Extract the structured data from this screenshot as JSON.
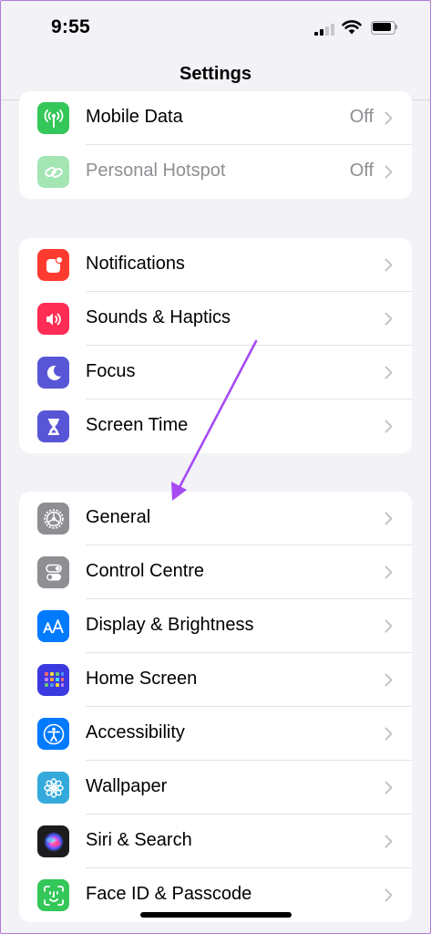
{
  "status": {
    "time": "9:55"
  },
  "nav": {
    "title": "Settings"
  },
  "groups": [
    {
      "items": [
        {
          "label": "Mobile Data",
          "value": "Off",
          "icon": "antenna-icon",
          "color": "#34c759"
        },
        {
          "label": "Personal Hotspot",
          "value": "Off",
          "icon": "link-icon",
          "color": "#34c759",
          "disabled": true
        }
      ]
    },
    {
      "items": [
        {
          "label": "Notifications",
          "icon": "bell-icon",
          "color": "#ff3b30"
        },
        {
          "label": "Sounds & Haptics",
          "icon": "speaker-icon",
          "color": "#ff2d55"
        },
        {
          "label": "Focus",
          "icon": "moon-icon",
          "color": "#5856d6"
        },
        {
          "label": "Screen Time",
          "icon": "hourglass-icon",
          "color": "#5856d6"
        }
      ]
    },
    {
      "items": [
        {
          "label": "General",
          "icon": "gear-icon",
          "color": "#8e8e93"
        },
        {
          "label": "Control Centre",
          "icon": "toggles-icon",
          "color": "#8e8e93"
        },
        {
          "label": "Display & Brightness",
          "icon": "text-size-icon",
          "color": "#007aff"
        },
        {
          "label": "Home Screen",
          "icon": "app-grid-icon",
          "color": "#3a3ae0"
        },
        {
          "label": "Accessibility",
          "icon": "accessibility-icon",
          "color": "#007aff"
        },
        {
          "label": "Wallpaper",
          "icon": "flower-icon",
          "color": "#34aadc"
        },
        {
          "label": "Siri & Search",
          "icon": "siri-icon",
          "color": "#1c1c1e"
        },
        {
          "label": "Face ID & Passcode",
          "icon": "face-id-icon",
          "color": "#34c759"
        }
      ]
    }
  ],
  "annotation": {
    "arrow_color": "#a64bf4"
  }
}
